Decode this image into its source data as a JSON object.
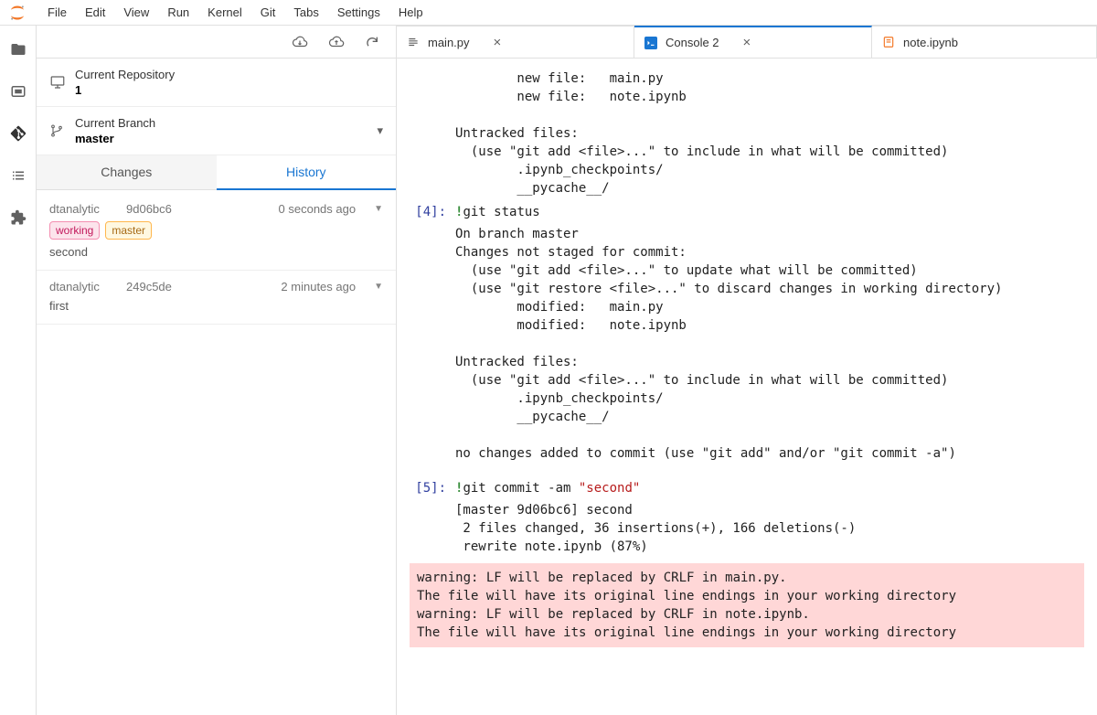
{
  "menu": [
    "File",
    "Edit",
    "View",
    "Run",
    "Kernel",
    "Git",
    "Tabs",
    "Settings",
    "Help"
  ],
  "sidebar": {
    "repo_label": "Current Repository",
    "repo_value": "1",
    "branch_label": "Current Branch",
    "branch_value": "master",
    "tabs": {
      "changes": "Changes",
      "history": "History"
    },
    "commits": [
      {
        "author": "dtanalytic",
        "sha": "9d06bc6",
        "when": "0 seconds ago",
        "badges": [
          "working",
          "master"
        ],
        "message": "second"
      },
      {
        "author": "dtanalytic",
        "sha": "249c5de",
        "when": "2 minutes ago",
        "badges": [],
        "message": "first"
      }
    ]
  },
  "tabs": [
    {
      "label": "main.py",
      "active": false,
      "icon": "file"
    },
    {
      "label": "Console 2",
      "active": true,
      "icon": "console"
    },
    {
      "label": "note.ipynb",
      "active": false,
      "icon": "notebook"
    }
  ],
  "console": {
    "output_top": "        new file:   main.py\n        new file:   note.ipynb\n\nUntracked files:\n  (use \"git add <file>...\" to include in what will be committed)\n        .ipynb_checkpoints/\n        __pycache__/\n",
    "cell4_prompt": "[4]:",
    "cell4_cmd": "git status",
    "cell4_out": "On branch master\nChanges not staged for commit:\n  (use \"git add <file>...\" to update what will be committed)\n  (use \"git restore <file>...\" to discard changes in working directory)\n        modified:   main.py\n        modified:   note.ipynb\n\nUntracked files:\n  (use \"git add <file>...\" to include in what will be committed)\n        .ipynb_checkpoints/\n        __pycache__/\n\nno changes added to commit (use \"git add\" and/or \"git commit -a\")",
    "cell5_prompt": "[5]:",
    "cell5_cmd_pre": "git commit -am ",
    "cell5_cmd_str": "\"second\"",
    "cell5_out": "[master 9d06bc6] second\n 2 files changed, 36 insertions(+), 166 deletions(-)\n rewrite note.ipynb (87%)",
    "cell5_warn": "warning: LF will be replaced by CRLF in main.py.\nThe file will have its original line endings in your working directory\nwarning: LF will be replaced by CRLF in note.ipynb.\nThe file will have its original line endings in your working directory"
  }
}
